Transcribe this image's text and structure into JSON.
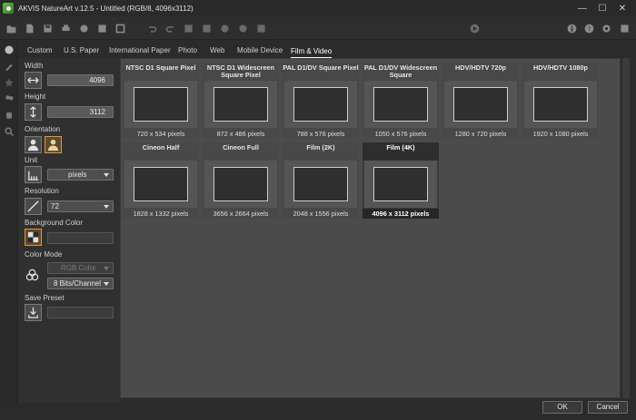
{
  "window": {
    "title": "AKVIS NatureArt v.12.5 - Untitled (RGB/8, 4096x3112)",
    "minimize": "—",
    "maximize": "☐",
    "close": "✕"
  },
  "tabs": [
    "Custom",
    "U.S. Paper",
    "International Paper",
    "Photo",
    "Web",
    "Mobile Device",
    "Film & Video"
  ],
  "active_tab": "Film & Video",
  "settings": {
    "width_label": "Width",
    "width_value": "4096",
    "height_label": "Height",
    "height_value": "3112",
    "orientation_label": "Orientation",
    "unit_label": "Unit",
    "unit_value": "pixels",
    "resolution_label": "Resolution",
    "resolution_value": "72",
    "background_label": "Background Color",
    "color_mode_label": "Color Mode",
    "color_mode_value": "RGB Color",
    "bits_value": "8 Bits/Channel",
    "save_preset_label": "Save Preset"
  },
  "presets": [
    {
      "name": "NTSC D1 Square Pixel",
      "size": "720 x 534 pixels"
    },
    {
      "name": "NTSC D1 Widescreen Square Pixel",
      "size": "872 x 486 pixels"
    },
    {
      "name": "PAL D1/DV Square Pixel",
      "size": "788 x 576 pixels"
    },
    {
      "name": "PAL D1/DV Widescreen Square",
      "size": "1050 x 576 pixels"
    },
    {
      "name": "HDV/HDTV 720p",
      "size": "1280 x 720 pixels"
    },
    {
      "name": "HDV/HDTV 1080p",
      "size": "1920 x 1080 pixels"
    },
    {
      "name": "Cineon Half",
      "size": "1828 x 1332 pixels"
    },
    {
      "name": "Cineon Full",
      "size": "3656 x 2664 pixels"
    },
    {
      "name": "Film (2K)",
      "size": "2048 x 1556 pixels"
    },
    {
      "name": "Film (4K)",
      "size": "4096 x 3112 pixels"
    }
  ],
  "selected_preset": "Film (4K)",
  "buttons": {
    "ok": "OK",
    "cancel": "Cancel"
  },
  "colors": {
    "accent": "#e09a3a",
    "panel": "#303030",
    "grid": "#4b4b4b"
  }
}
